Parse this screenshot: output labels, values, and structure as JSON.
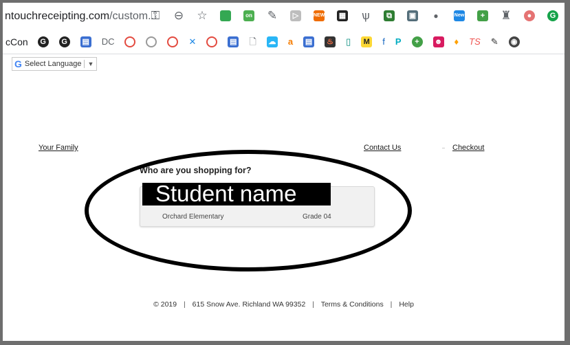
{
  "browser": {
    "url_main": "ntouchreceipting.com",
    "url_rest": "/custom...",
    "bookmark_label": "cCon",
    "bookmark_dc_label": "DC",
    "ext_badge_on": "on",
    "ext_badge_new": "NEW",
    "ext_badge_new2": "New"
  },
  "translate": {
    "g": "G",
    "label": "Select Language",
    "caret": "▼"
  },
  "nav": {
    "your_family": "Your Family",
    "contact_us": "Contact Us",
    "checkout": "Checkout"
  },
  "shopping": {
    "question": "Who are you shopping for?",
    "student_name": "Student name",
    "school": "Orchard Elementary",
    "grade": "Grade 04"
  },
  "footer": {
    "copyright": "© 2019",
    "address": "615 Snow Ave. Richland WA 99352",
    "terms": "Terms & Conditions",
    "help": "Help"
  },
  "colors": {
    "annotation": "#000000",
    "card_bg": "#f1f1f1"
  }
}
